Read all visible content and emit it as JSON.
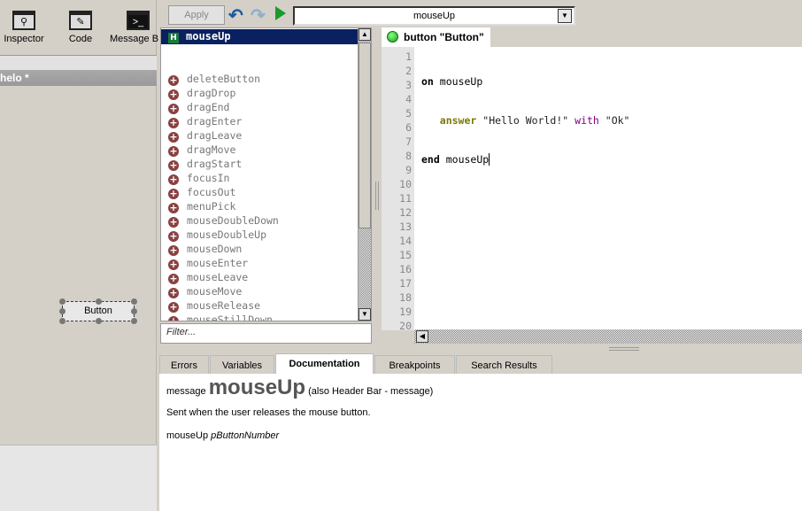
{
  "left_toolbar": [
    {
      "label": "Inspector",
      "icon": "magnifier-icon"
    },
    {
      "label": "Code",
      "icon": "code-icon"
    },
    {
      "label": "Message B",
      "icon": "terminal-icon"
    }
  ],
  "stack_title": "helo *",
  "canvas_button_label": "Button",
  "toolbar": {
    "apply_label": "Apply",
    "handler_select": "mouseUp"
  },
  "handlers": {
    "selected": "mouseUp",
    "selected_badge": "H",
    "items": [
      "deleteButton",
      "dragDrop",
      "dragEnd",
      "dragEnter",
      "dragLeave",
      "dragMove",
      "dragStart",
      "focusIn",
      "focusOut",
      "menuPick",
      "mouseDoubleDown",
      "mouseDoubleUp",
      "mouseDown",
      "mouseEnter",
      "mouseLeave",
      "mouseMove",
      "mouseRelease",
      "mouseStillDown"
    ],
    "filter_placeholder": "Filter..."
  },
  "script_tab": "button \"Button\"",
  "code": {
    "line_count": 20,
    "l1_kw": "on",
    "l1_name": "mouseUp",
    "l2_cmd": "answer",
    "l2_str1": "\"Hello World!\"",
    "l2_with": "with",
    "l2_str2": "\"Ok\"",
    "l3_kw": "end",
    "l3_name": "mouseUp"
  },
  "bottom_tabs": [
    "Errors",
    "Variables",
    "Documentation",
    "Breakpoints",
    "Search Results"
  ],
  "active_tab": "Documentation",
  "doc": {
    "type": "message",
    "name": "mouseUp",
    "also": "(also Header Bar - message)",
    "description": "Sent when the user releases the mouse button.",
    "syntax_name": "mouseUp",
    "syntax_param": "pButtonNumber"
  }
}
